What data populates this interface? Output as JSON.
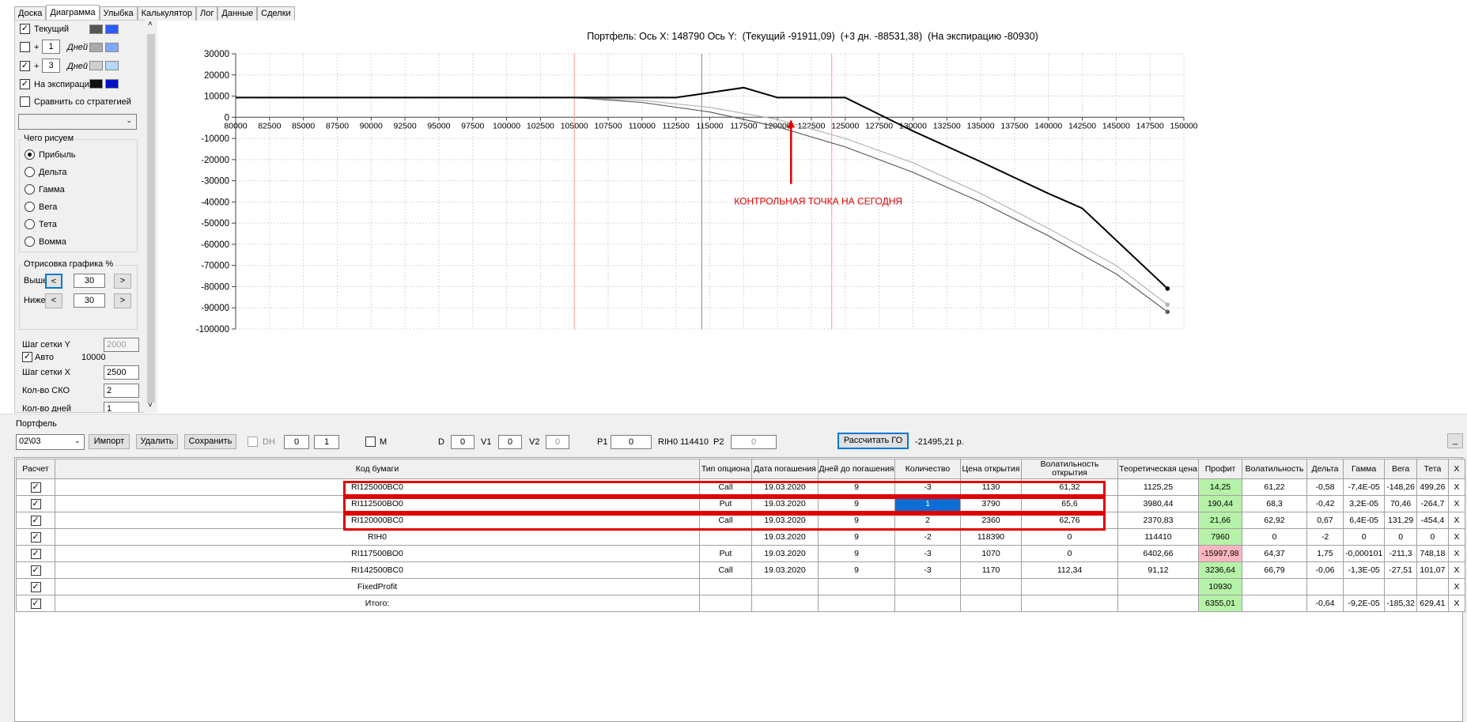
{
  "tabs": [
    "Доска",
    "Диаграмма",
    "Улыбка",
    "Калькулятор",
    "Лог",
    "Данные",
    "Сделки"
  ],
  "left_panel": {
    "current": {
      "label": "Текущий",
      "checked": true
    },
    "plus1": {
      "prefix": "+",
      "value": "1",
      "unit": "Дней",
      "checked": false
    },
    "plus3": {
      "prefix": "+",
      "value": "3",
      "unit": "Дней",
      "checked": true
    },
    "expiry": {
      "label": "На экспирацию",
      "checked": true
    },
    "compare": {
      "label": "Сравнить со стратегией",
      "checked": false
    },
    "draw_group_title": "Чего рисуем",
    "draw_options": [
      "Прибыль",
      "Дельта",
      "Гамма",
      "Вега",
      "Тета",
      "Вомма"
    ],
    "draw_selected": 0,
    "range_group_title": "Отрисовка графика %",
    "above_label": "Выше",
    "above_value": "30",
    "below_label": "Ниже",
    "below_value": "30",
    "prev_btn": "<",
    "next_btn": ">",
    "grid_y_label": "Шаг сетки Y",
    "grid_y_value": "2000",
    "auto_label": "Авто",
    "auto_value": "10000",
    "grid_x_label": "Шаг сетки X",
    "grid_x_value": "2500",
    "sko_label": "Кол-во СКО",
    "sko_value": "2",
    "days_label": "Кол-во дней",
    "days_value": "1"
  },
  "colors": {
    "accent": "#0d6fd3",
    "profit_pos": "#b6f2a8",
    "profit_neg": "#ffb6c1",
    "highlight": "#e00000"
  },
  "chart_data": {
    "type": "line",
    "title": "Портфель: Ось X: 148790 Ось Y:  (Текущий -91911,09)  (+3 дн. -88531,38)  (На экспирацию -80930)",
    "xlim": [
      80000,
      150000
    ],
    "ylim": [
      -100000,
      30000
    ],
    "x_ticks": [
      80000,
      82500,
      85000,
      87500,
      90000,
      92500,
      95000,
      97500,
      100000,
      102500,
      105000,
      107500,
      110000,
      112500,
      115000,
      117500,
      120000,
      122500,
      125000,
      127500,
      130000,
      132500,
      135000,
      137500,
      140000,
      142500,
      145000,
      147500,
      150000
    ],
    "y_ticks": [
      30000,
      20000,
      10000,
      0,
      -10000,
      -20000,
      -30000,
      -40000,
      -50000,
      -60000,
      -70000,
      -80000,
      -90000,
      -100000
    ],
    "grid": true,
    "vlines": [
      {
        "x": 105000,
        "color": "#ffaaaa"
      },
      {
        "x": 114410,
        "color": "#8a96b0"
      },
      {
        "x": 124000,
        "color": "#ffaaaa"
      }
    ],
    "series": [
      {
        "color": "#000000",
        "points": [
          [
            80000,
            9300
          ],
          [
            112500,
            9300
          ],
          [
            117500,
            14000
          ],
          [
            120000,
            9300
          ],
          [
            125000,
            9300
          ],
          [
            130000,
            -6500
          ],
          [
            135000,
            -21000
          ],
          [
            140000,
            -36000
          ],
          [
            142500,
            -43000
          ],
          [
            148790,
            -80930
          ]
        ]
      },
      {
        "color": "#b4b4b4",
        "points": [
          [
            80000,
            9300
          ],
          [
            105000,
            9300
          ],
          [
            110000,
            8000
          ],
          [
            115000,
            4700
          ],
          [
            120000,
            -1000
          ],
          [
            125000,
            -10000
          ],
          [
            130000,
            -21500
          ],
          [
            135000,
            -36000
          ],
          [
            140000,
            -52500
          ],
          [
            145000,
            -70000
          ],
          [
            148790,
            -88531
          ]
        ]
      },
      {
        "color": "#606060",
        "points": [
          [
            80000,
            9300
          ],
          [
            105000,
            9300
          ],
          [
            110000,
            7000
          ],
          [
            115000,
            2500
          ],
          [
            120000,
            -4500
          ],
          [
            125000,
            -14000
          ],
          [
            130000,
            -26000
          ],
          [
            135000,
            -40000
          ],
          [
            140000,
            -56000
          ],
          [
            145000,
            -74000
          ],
          [
            148790,
            -91911
          ]
        ]
      }
    ],
    "annotation": {
      "text": "КОНТРОЛЬНАЯ ТОЧКА НА СЕГОДНЯ",
      "x": 121000,
      "y": -30000
    }
  },
  "portfolio": {
    "title": "Портфель",
    "name": "02\\03",
    "import_btn": "Импорт",
    "delete_btn": "Удалить",
    "save_btn": "Сохранить",
    "dh_label": "DH",
    "dh_v1": "0",
    "dh_v2": "1",
    "m_label": "M",
    "d_label": "D",
    "d_value": "0",
    "v1_label": "V1",
    "v1_value": "0",
    "v2_label": "V2",
    "v2_value": "0",
    "p1_label": "P1",
    "p1_value": "0",
    "rih_label": "RIH0 114410",
    "p2_label": "P2",
    "p2_value": "0",
    "calc_btn": "Рассчитать ГО",
    "go_value": "-21495,21 р.",
    "min_btn": "_"
  },
  "table": {
    "headers": [
      "Расчет",
      "Код бумаги",
      "Тип опциона",
      "Дата погашения",
      "Дней до погашения",
      "Количество",
      "Цена открытия",
      "Волатильность открытия",
      "Теоретическая цена",
      "Профит",
      "Волатильность",
      "Дельта",
      "Гамма",
      "Вега",
      "Тета",
      "X"
    ],
    "rows": [
      [
        "RI125000BC0",
        "Call",
        "19.03.2020",
        "9",
        "-3",
        "1130",
        "61,32",
        "1125,25",
        "14,25",
        "61,22",
        "-0,58",
        "-7,4E-05",
        "-148,26",
        "499,26"
      ],
      [
        "RI112500BO0",
        "Put",
        "19.03.2020",
        "9",
        "1",
        "3790",
        "65,6",
        "3980,44",
        "190,44",
        "68,3",
        "-0,42",
        "3,2E-05",
        "70,46",
        "-264,7"
      ],
      [
        "RI120000BC0",
        "Call",
        "19.03.2020",
        "9",
        "2",
        "2360",
        "62,76",
        "2370,83",
        "21,66",
        "62,92",
        "0,67",
        "6,4E-05",
        "131,29",
        "-454,4"
      ],
      [
        "RIH0",
        "",
        "19.03.2020",
        "9",
        "-2",
        "118390",
        "0",
        "114410",
        "7960",
        "0",
        "-2",
        "0",
        "0",
        "0"
      ],
      [
        "RI117500BO0",
        "Put",
        "19.03.2020",
        "9",
        "-3",
        "1070",
        "0",
        "6402,66",
        "-15997,98",
        "64,37",
        "1,75",
        "-0,000101",
        "-211,3",
        "748,18"
      ],
      [
        "RI142500BC0",
        "Call",
        "19.03.2020",
        "9",
        "-3",
        "1170",
        "112,34",
        "91,12",
        "3236,64",
        "66,79",
        "-0,06",
        "-1,3E-05",
        "-27,51",
        "101,07"
      ],
      [
        "FixedProfit",
        "",
        "",
        "",
        "",
        "",
        "",
        "",
        "10930",
        "",
        "",
        "",
        "",
        ""
      ],
      [
        "Итого:",
        "",
        "",
        "",
        "",
        "",
        "",
        "",
        "6355,01",
        "",
        "-0,64",
        "-9,2E-05",
        "-185,32",
        "629,41"
      ]
    ],
    "delete_label": "X"
  }
}
